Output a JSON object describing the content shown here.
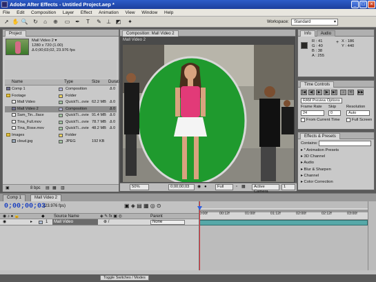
{
  "window": {
    "title": "Adobe After Effects - Untitled Project.aep *",
    "min_icon": "minimize-icon",
    "max_icon": "maximize-icon",
    "close_icon": "close-icon"
  },
  "menu": [
    "File",
    "Edit",
    "Composition",
    "Layer",
    "Effect",
    "Animation",
    "View",
    "Window",
    "Help"
  ],
  "toolbar": {
    "workspace_label": "Workspace:",
    "workspace_value": "Standard"
  },
  "project": {
    "tab": "Project",
    "item_name": "Mall Video 2 ▾",
    "item_dims": "1280 x 720 (1.00)",
    "item_duration": "Δ 0;00;03;02, 23.976 fps",
    "columns": {
      "name": "Name",
      "type": "Type",
      "size": "Size",
      "duration": "Duration"
    },
    "rows": [
      {
        "name": "Comp 1",
        "type": "Composition",
        "size": "",
        "dur": "Δ 0",
        "icon": "comp",
        "indent": 0
      },
      {
        "name": "Footage",
        "type": "Folder",
        "size": "",
        "dur": "",
        "icon": "folder",
        "indent": 0
      },
      {
        "name": "Mall Video",
        "type": "QuickTi...ovie",
        "size": "62.2 MB",
        "dur": "Δ 0",
        "icon": "film",
        "indent": 1
      },
      {
        "name": "Mall Video 2",
        "type": "Composition",
        "size": "",
        "dur": "Δ 0",
        "icon": "comp",
        "indent": 1,
        "selected": true
      },
      {
        "name": "Sam_Tin...Ilace",
        "type": "QuickTi...ovie",
        "size": "91.4 MB",
        "dur": "Δ 0",
        "icon": "film",
        "indent": 1
      },
      {
        "name": "Tina_Full.mov",
        "type": "QuickTi...ovie",
        "size": "78.7 MB",
        "dur": "Δ 0",
        "icon": "film",
        "indent": 1
      },
      {
        "name": "Tina_Rose.mov",
        "type": "QuickTi...ovie",
        "size": "48.2 MB",
        "dur": "Δ 0",
        "icon": "film",
        "indent": 1
      },
      {
        "name": "Images",
        "type": "Folder",
        "size": "",
        "dur": "",
        "icon": "folder",
        "indent": 0
      },
      {
        "name": "cloud.jpg",
        "type": "JPEG",
        "size": "192 KB",
        "dur": "",
        "icon": "img",
        "indent": 1
      }
    ],
    "bpc": "8 bpc"
  },
  "composition": {
    "tab": "Composition: Mall Video 2",
    "zoom": "50%",
    "timecode": "0;00;00;03",
    "resolution": "Full",
    "camera": "Active Camera",
    "views": "1 View"
  },
  "info": {
    "tabs": [
      "Info",
      "Audio"
    ],
    "r": "R : 41",
    "g": "G : 40",
    "b": "B : 38",
    "a": "A : 255",
    "x": "X : 186",
    "y": "Y : 440"
  },
  "time_controls": {
    "tab": "Time Controls",
    "ram_preview": "RAM Preview Options",
    "frame_rate_label": "Frame Rate",
    "skip_label": "Skip",
    "resolution_label": "Resolution",
    "frame_rate": "24",
    "skip": "0",
    "resolution": "Auto",
    "from_current": "From Current Time",
    "full_screen": "Full Screen"
  },
  "effects": {
    "tab": "Effects & Presets",
    "contains_label": "Contains:",
    "items": [
      "* Animation Presets",
      "3D Channel",
      "Audio",
      "Blur & Sharpen",
      "Channel",
      "Color Correction"
    ]
  },
  "timeline": {
    "tabs": [
      "Comp 1",
      "Mall Video 2"
    ],
    "timecode": "0;00;00;03",
    "fps": "(23.976 fps)",
    "source_name_label": "Source Name",
    "parent_label": "Parent",
    "layer_num": "1",
    "layer_name": "Mall Video",
    "layer_parent": "None",
    "ruler": [
      "0:00f",
      "00:12f",
      "01:00f",
      "01:12f",
      "02:00f",
      "02:12f",
      "03:00f"
    ],
    "toggle": "Toggle Switches / Modes"
  }
}
